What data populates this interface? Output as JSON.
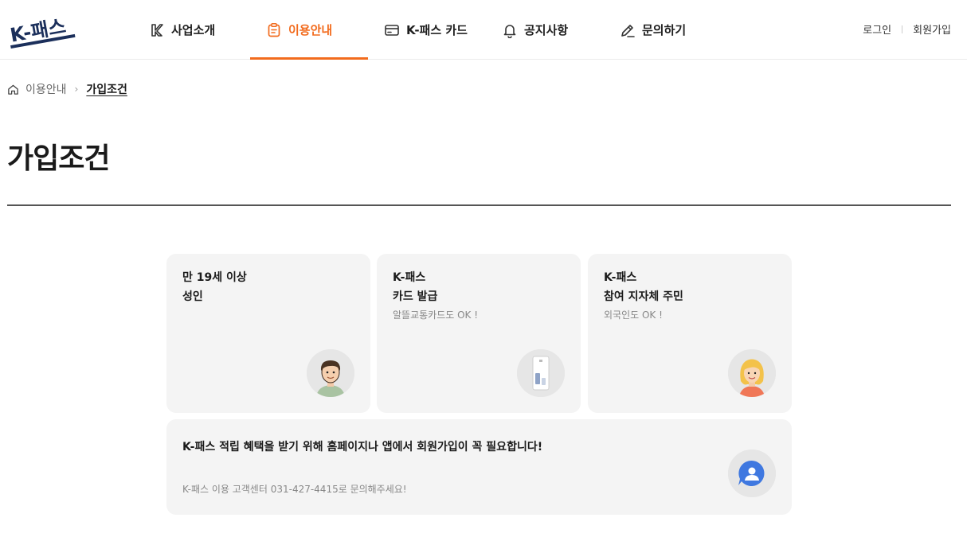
{
  "header": {
    "logo_alt": "K-패스",
    "nav": [
      {
        "label": "사업소개",
        "icon": "k-logo-icon"
      },
      {
        "label": "이용안내",
        "icon": "clipboard-icon",
        "active": true
      },
      {
        "label": "K-패스 카드",
        "icon": "card-icon"
      },
      {
        "label": "공지사항",
        "icon": "bell-icon"
      },
      {
        "label": "문의하기",
        "icon": "pencil-icon"
      }
    ],
    "login": "로그인",
    "signup": "회원가입"
  },
  "breadcrumb": {
    "home_icon": "home-icon",
    "parent": "이용안내",
    "current": "가입조건"
  },
  "page_title": "가입조건",
  "cards": [
    {
      "line1": "만 19세 이상",
      "line2": "성인",
      "sub": "",
      "icon": "man-avatar-icon"
    },
    {
      "line1": "K-패스",
      "line2": "카드 발급",
      "sub": "알뜰교통카드도 OK !",
      "icon": "transit-card-icon"
    },
    {
      "line1": "K-패스",
      "line2": "참여 지자체 주민",
      "sub": "외국인도 OK !",
      "icon": "woman-avatar-icon"
    }
  ],
  "notice": {
    "message": "K-패스 적립 혜택을 받기 위해 홈페이지나 앱에서 회원가입이 꼭 필요합니다!",
    "contact": "K-패스 이용 고객센터 031-427-4415로 문의해주세요!",
    "icon": "chat-user-icon"
  },
  "colors": {
    "accent": "#f26b1d",
    "brand_navy": "#1b2f5b",
    "card_bg": "#f4f4f4",
    "chat_blue": "#3f78e0"
  }
}
